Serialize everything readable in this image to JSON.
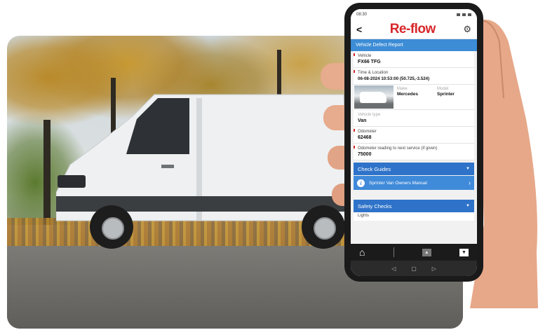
{
  "status_bar": {
    "time": "08:30"
  },
  "header": {
    "back_label": "<",
    "logo": "Re-flow",
    "settings_icon": "gear-icon"
  },
  "title_bar": {
    "title": "Vehicle Defect Report"
  },
  "fields": {
    "vehicle": {
      "label": "Vehicle",
      "value": "FX66 TFG"
    },
    "time_location": {
      "label": "Time & Location",
      "value": "06-08-2024 10:53:00 (50.725,-3.524)"
    },
    "make": {
      "label": "Make",
      "value": "Mercedes"
    },
    "model": {
      "label": "Model",
      "value": "Sprinter"
    },
    "vehicle_type": {
      "label": "Vehicle type",
      "value": "Van"
    },
    "odometer": {
      "label": "Odometer",
      "value": "62468"
    },
    "odometer_next": {
      "label": "Odometer reading to next service (if given)",
      "value": "75000"
    }
  },
  "sections": {
    "check_guides": "Check Guides",
    "manual_link": "Sprinter Van Owners Manual",
    "safety_checks": "Safety Checks",
    "lights_label": "Lights"
  },
  "colors": {
    "brand_red": "#d7262a",
    "accent_blue": "#2e73c9",
    "title_blue": "#3c8cd6"
  }
}
